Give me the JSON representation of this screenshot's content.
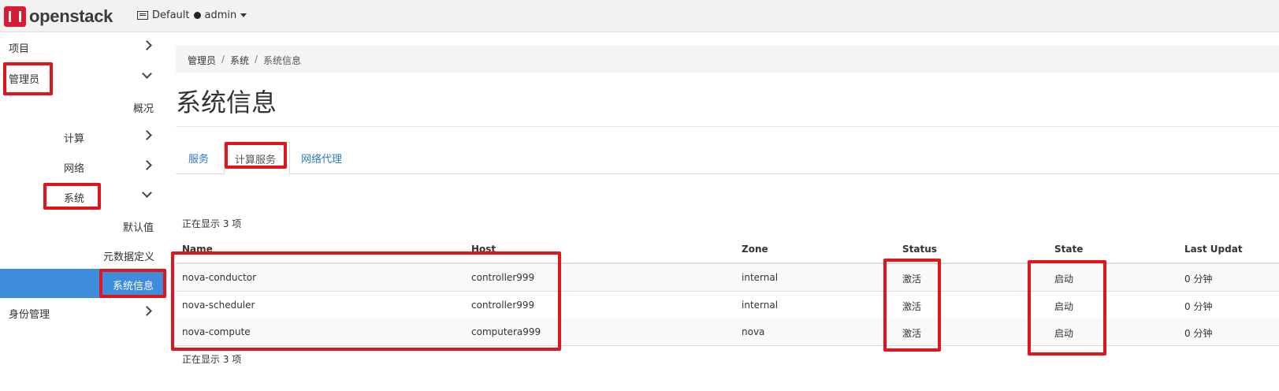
{
  "navbar": {
    "logo_text": "openstack",
    "domain": "Default",
    "user": "admin"
  },
  "sidebar": {
    "items": [
      {
        "label": "项目"
      },
      {
        "label": "管理员"
      },
      {
        "label": "概况"
      },
      {
        "label": "计算"
      },
      {
        "label": "网络"
      },
      {
        "label": "系统"
      },
      {
        "label": "默认值"
      },
      {
        "label": "元数据定义"
      },
      {
        "label": "系统信息"
      },
      {
        "label": "身份管理"
      }
    ]
  },
  "breadcrumb": [
    "管理员",
    "/",
    "系统",
    "/",
    "系统信息"
  ],
  "page": {
    "title": "系统信息"
  },
  "tabs": [
    {
      "label": "服务"
    },
    {
      "label": "计算服务"
    },
    {
      "label": "网络代理"
    }
  ],
  "table": {
    "count_top": "正在显示 3 项",
    "count_bottom": "正在显示 3 项",
    "columns": [
      "Name",
      "Host",
      "Zone",
      "Status",
      "State",
      "Last Updat"
    ],
    "rows": [
      [
        "nova-conductor",
        "controller999",
        "internal",
        "激活",
        "启动",
        "0 分钟"
      ],
      [
        "nova-scheduler",
        "controller999",
        "internal",
        "激活",
        "启动",
        "0 分钟"
      ],
      [
        "nova-compute",
        "computera999",
        "nova",
        "激活",
        "启动",
        "0 分钟"
      ]
    ]
  },
  "colors": {
    "active_nav": "#3e8ddd",
    "link": "#2a7bc1",
    "highlight": "#e0161f"
  }
}
